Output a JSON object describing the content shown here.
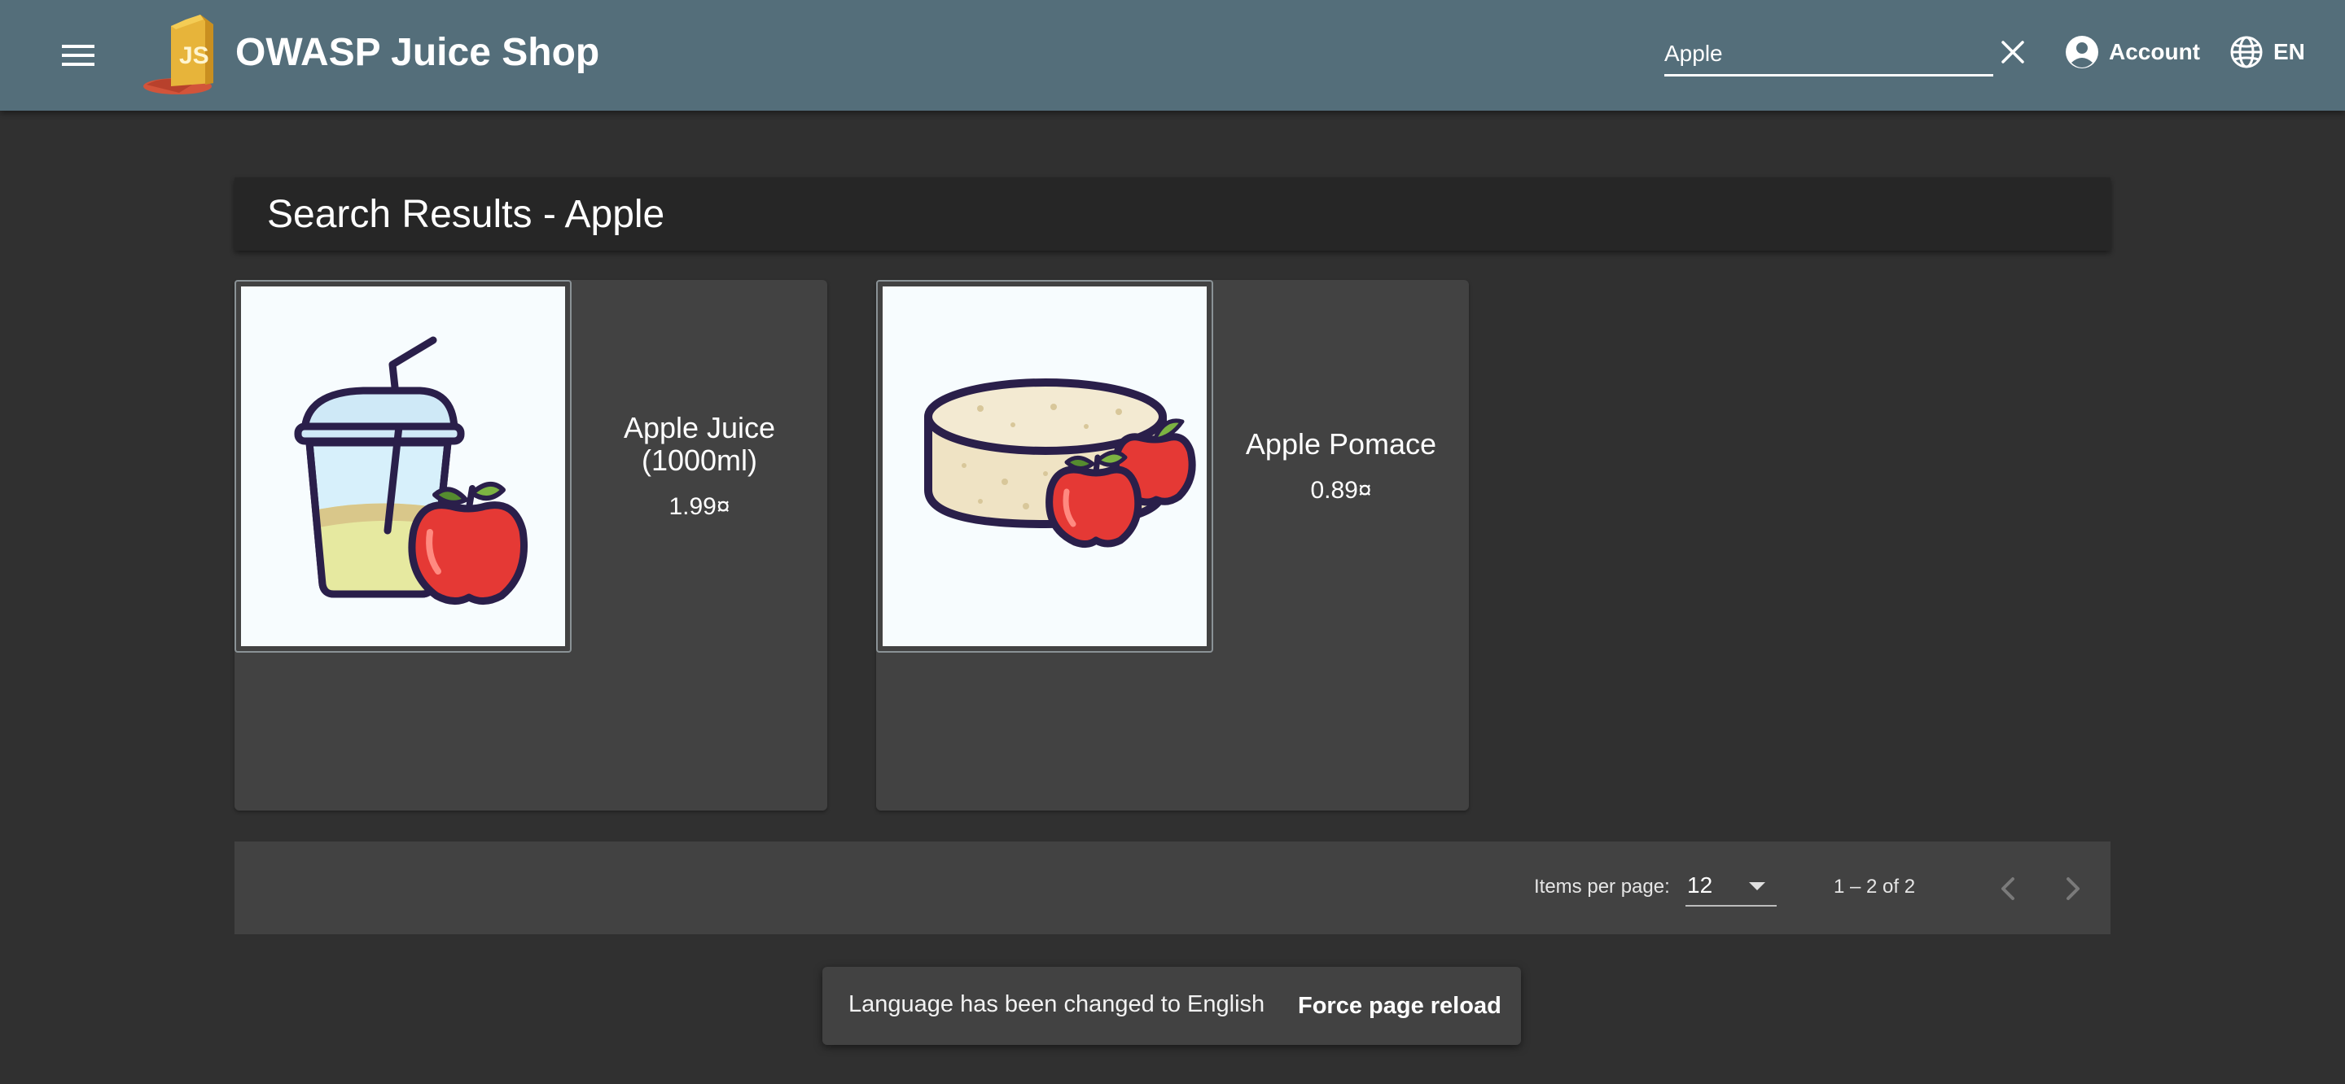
{
  "header": {
    "app_title": "OWASP Juice Shop",
    "search_value": "Apple",
    "account_label": "Account",
    "language_label": "EN"
  },
  "main": {
    "heading": "Search Results - Apple",
    "products": [
      {
        "name": "Apple Juice (1000ml)",
        "price": "1.99¤",
        "image_icon": "apple-juice-icon"
      },
      {
        "name": "Apple Pomace",
        "price": "0.89¤",
        "image_icon": "apple-pomace-icon"
      }
    ]
  },
  "paginator": {
    "items_per_page_label": "Items per page:",
    "items_per_page_value": "12",
    "range_label": "1 – 2 of 2"
  },
  "snackbar": {
    "message": "Language has been changed to English",
    "action_label": "Force page reload"
  },
  "colors": {
    "toolbar": "#546e7a",
    "background": "#303030",
    "card": "#424242"
  }
}
